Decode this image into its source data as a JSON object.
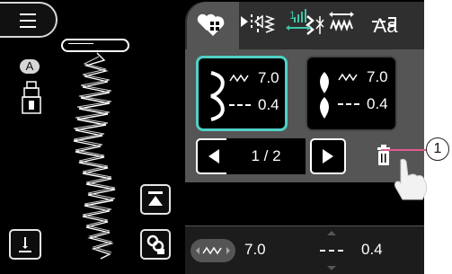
{
  "sidebar": {
    "presser_foot_letter": "A"
  },
  "tabs": {
    "aa_label": "Aa"
  },
  "cards": {
    "left": {
      "width_value": "7.0",
      "length_value": "0.4"
    },
    "right": {
      "width_value": "7.0",
      "length_value": "0.4"
    }
  },
  "pagination": {
    "page_text": "1 / 2"
  },
  "bottom": {
    "width_value": "7.0",
    "length_value": "0.4"
  },
  "callout": {
    "number": "1"
  },
  "colors": {
    "accent": "#4fd0c7",
    "callout_line": "#e15a8e",
    "tool_highlight": "#3fc5a8"
  }
}
